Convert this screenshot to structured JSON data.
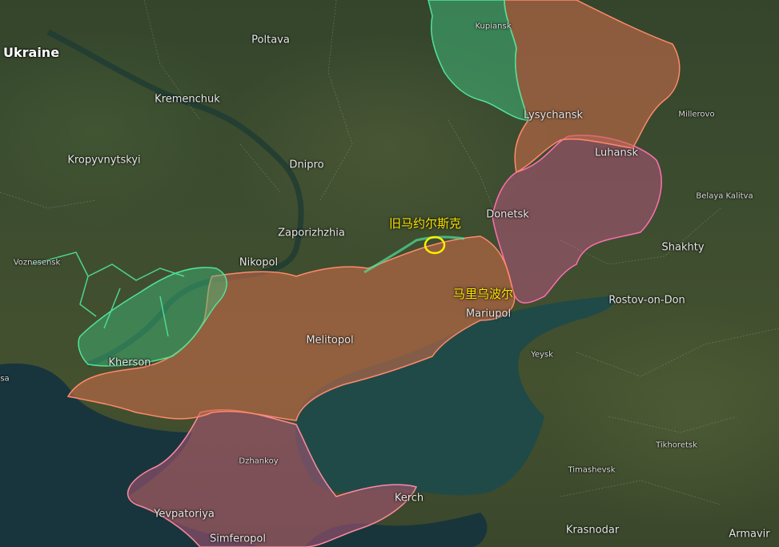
{
  "colors": {
    "occupied_fill": "#c86a4a",
    "occupied_border": "#ff8a6a",
    "liberated_fill": "#3fbf7f",
    "liberated_border": "#4fe39a",
    "pre2022_fill": "#b0567a",
    "pre2022_border": "#ff6fb0",
    "sea": "#1f4a4a",
    "marker": "#ffee00"
  },
  "country_label": "Ukraine",
  "cities": {
    "poltava": "Poltava",
    "kupiansk": "Kupiansk",
    "kremenchuk": "Kremenchuk",
    "lysychansk": "Lysychansk",
    "millerovo": "Millerovo",
    "luhansk": "Luhansk",
    "kropyvnytskyi": "Kropyvnytskyi",
    "dnipro": "Dnipro",
    "belaya_kalitva": "Belaya Kalitva",
    "donetsk": "Donetsk",
    "zaporizhzhia": "Zaporizhzhia",
    "shakhty": "Shakhty",
    "voznesensk": "Voznesensk",
    "nikopol": "Nikopol",
    "mariupol": "Mariupol",
    "rostov": "Rostov-on-Don",
    "kherson": "Kherson",
    "melitopol": "Melitopol",
    "yeysk": "Yeysk",
    "odesa_fragment": "sa",
    "tikhoretsk": "Tikhoretsk",
    "dzhankoy": "Dzhankoy",
    "timashevsk": "Timashevsk",
    "kerch": "Kerch",
    "yevpatoriya": "Yevpatoriya",
    "krasnodar": "Krasnodar",
    "armavir": "Armavir",
    "simferopol": "Simferopol"
  },
  "annotations": {
    "staromaiorske": "旧马约尔斯克",
    "mariupol_cn": "马里乌波尔"
  }
}
